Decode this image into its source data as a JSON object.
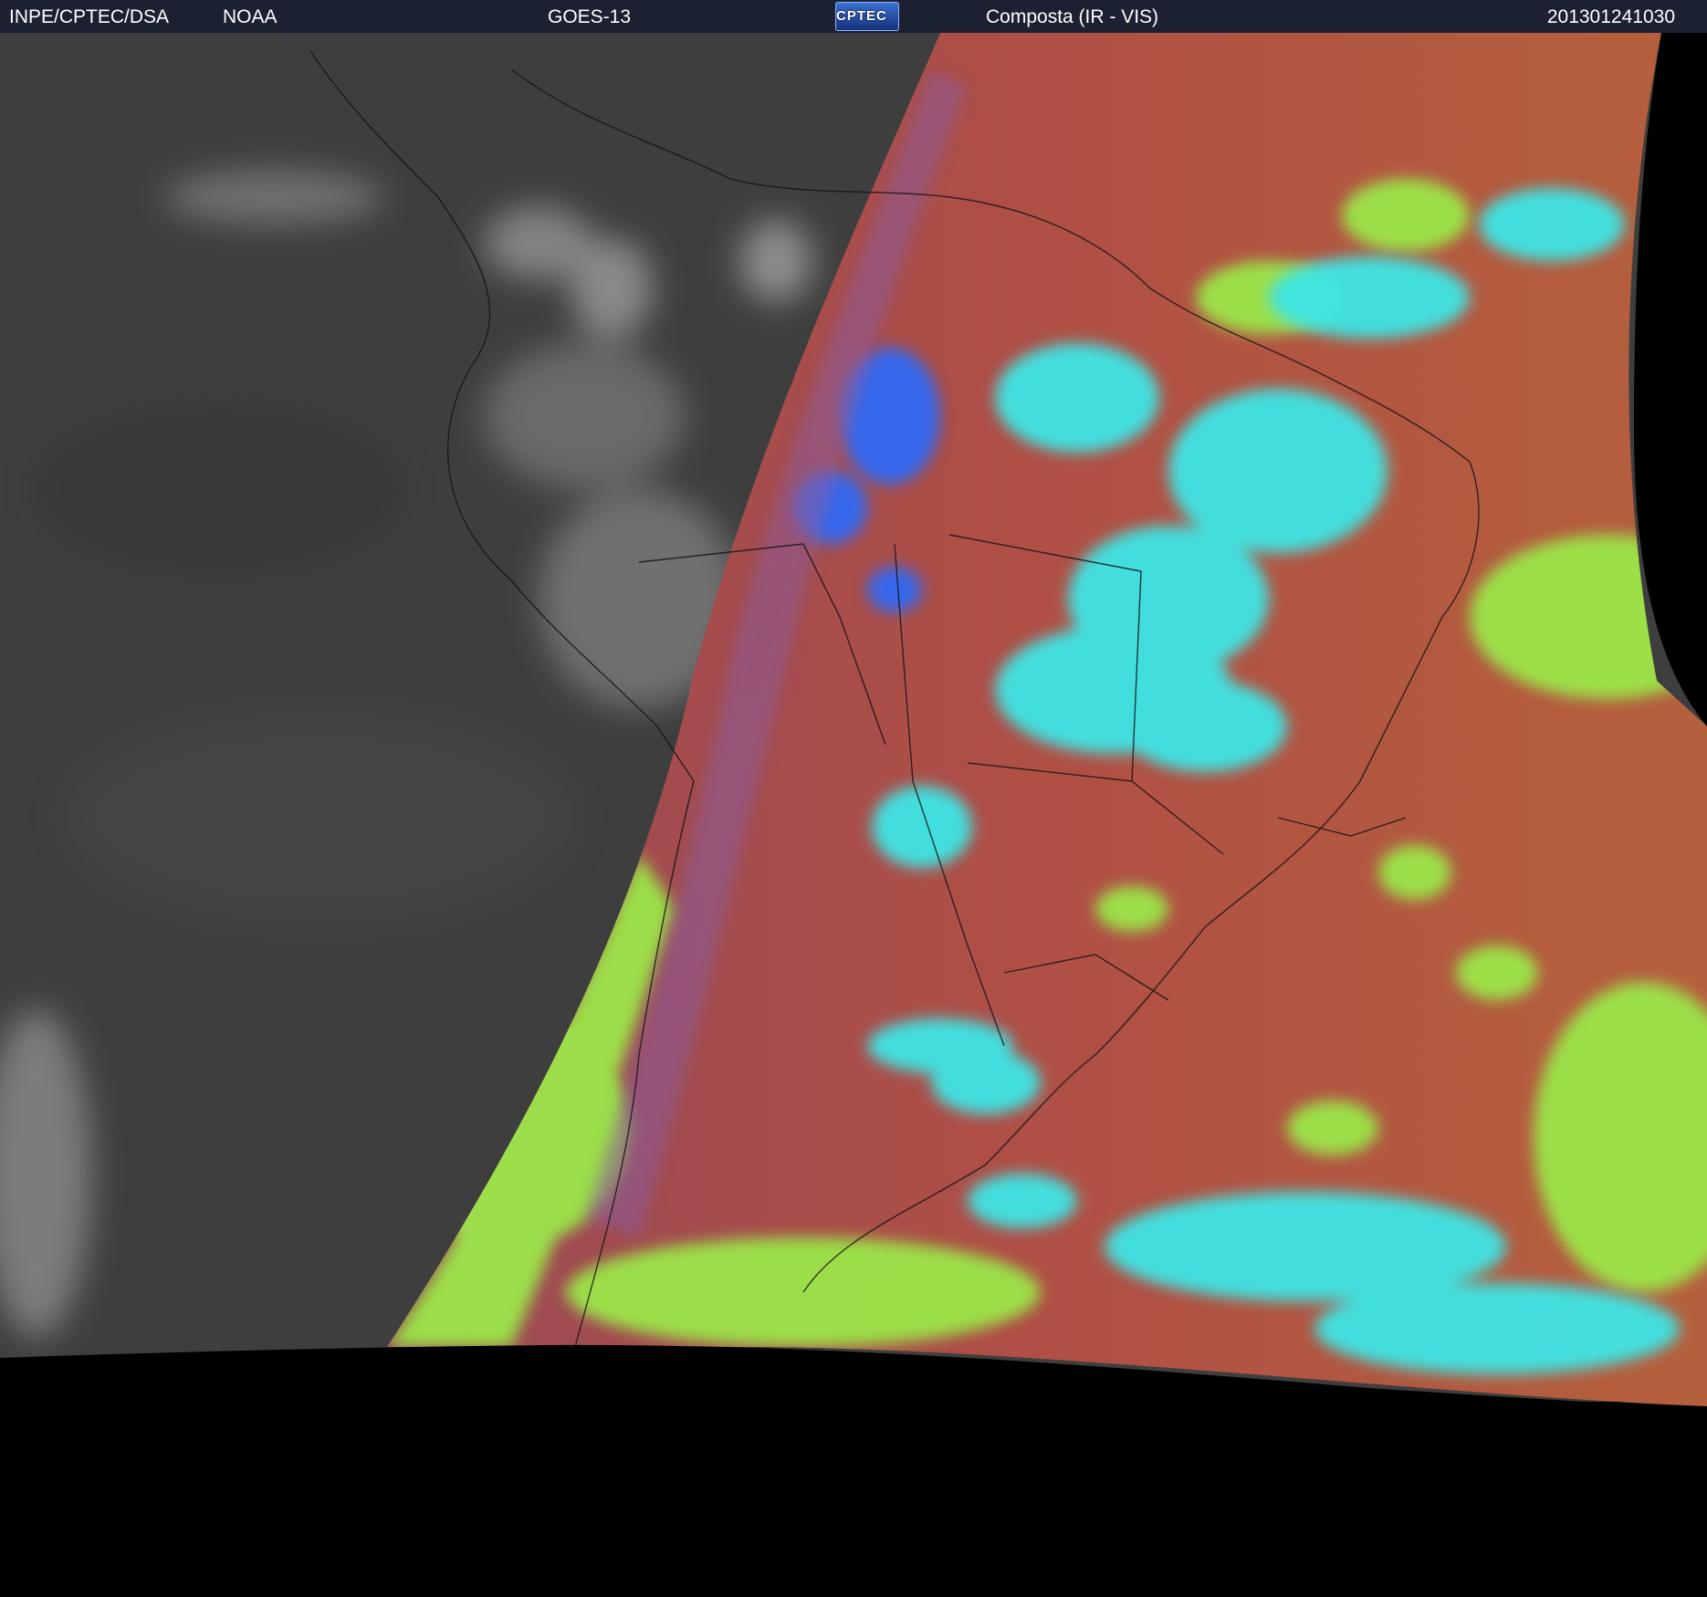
{
  "header": {
    "source": "INPE/CPTEC/DSA",
    "agency": "NOAA",
    "satellite": "GOES-13",
    "logo_text": "CPTEC",
    "product": "Composta (IR - VIS)",
    "timestamp": "201301241030"
  },
  "image": {
    "content": "GOES-13 satellite composite over South America",
    "colors": {
      "night_ir": "#3c3c3c",
      "day_surface": "#a84d48",
      "low_cloud": "#9be64a",
      "high_cloud": "#3ee6e6",
      "deep_convection": "#2a6cff",
      "off_disk": "#000000",
      "header_bg": "#1b2130"
    }
  }
}
